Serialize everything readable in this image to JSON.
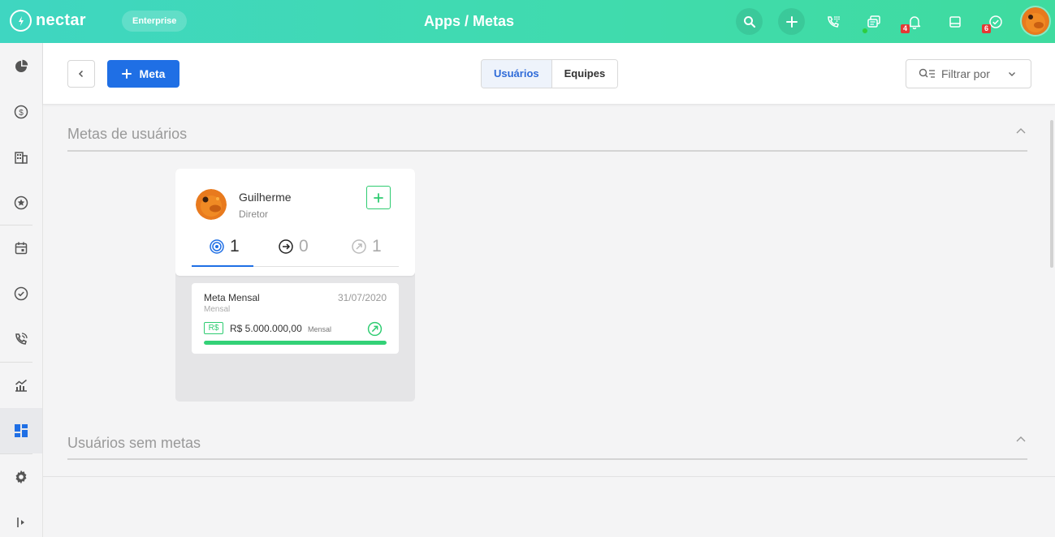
{
  "app": {
    "logo_text": "nectar",
    "plan_label": "Enterprise",
    "title": "Apps / Metas"
  },
  "topbar": {
    "icons": [
      "search-icon",
      "plus-icon",
      "dialpad-phone-icon",
      "chat-icon",
      "bell-icon",
      "inbox-icon",
      "check-circle-icon"
    ],
    "notifications_count": "4",
    "tasks_count": "6"
  },
  "sidebar": {
    "items": [
      "pie-chart-icon",
      "dollar-icon",
      "building-icon",
      "star-icon",
      "calendar-icon",
      "check-circle-icon",
      "phone-icon",
      "chart-icon",
      "dashboard-icon",
      "gear-icon",
      "expand-sidebar-icon"
    ],
    "active": "dashboard-icon"
  },
  "header": {
    "add_button_label": "Meta",
    "tabs": [
      {
        "label": "Usuários",
        "active": true
      },
      {
        "label": "Equipes",
        "active": false
      }
    ],
    "filter_label": "Filtrar por"
  },
  "sections": {
    "with_goals_title": "Metas de usuários",
    "without_goals_title": "Usuários sem metas"
  },
  "user_card": {
    "name": "Guilherme",
    "role": "Diretor",
    "stats": {
      "active": "1",
      "in_progress": "0",
      "completed": "1"
    }
  },
  "goal": {
    "name": "Meta Mensal",
    "date": "31/07/2020",
    "period": "Mensal",
    "currency_tag": "R$",
    "value": "R$ 5.000.000,00",
    "value_period": "Mensal",
    "progress": 1.0
  },
  "colors": {
    "brand_green": "#3fdb9f",
    "primary_blue": "#1f6fe5",
    "success_green": "#2ecc71"
  }
}
